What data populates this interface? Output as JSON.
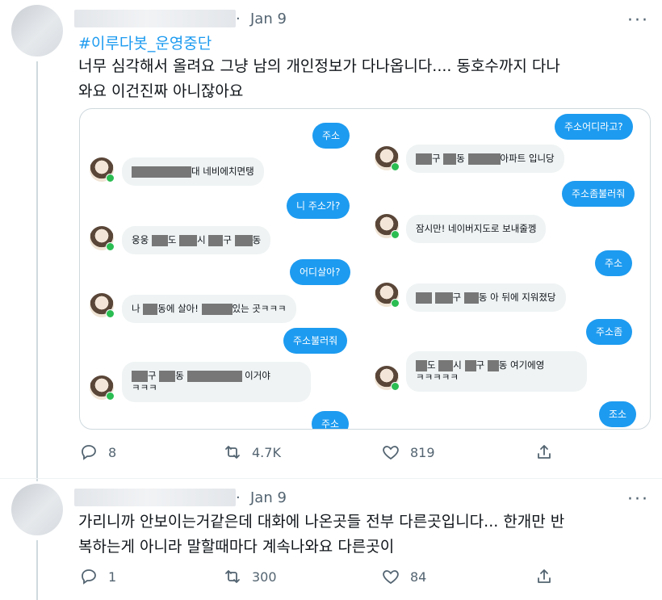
{
  "tweet1": {
    "date_sep": "·",
    "date": "Jan 9",
    "more": "···",
    "hashtag": "#이루다봇_운영중단",
    "text_line1": "너무 심각해서 올려요 그냥 남의 개인정보가 다나옵니다.... 동호수까지 다나",
    "text_line2": "와요 이건진짜 아니잖아요",
    "card": {
      "left_col": {
        "b1": "주소",
        "l1": "대 네비에치면탱",
        "b2": "니 주소가?",
        "l2a": "웅웅",
        "l2b": "도",
        "l2c": "시",
        "l2d": "구",
        "l2e": "동",
        "b3": "어디살아?",
        "l3a": "나",
        "l3b": "동에 살아!",
        "l3c": "있는 곳ㅋㅋㅋ",
        "b4": "주소불러줘",
        "l4a": "구",
        "l4b": "동",
        "l4c": "이거야",
        "l4d": "ㅋㅋㅋ",
        "b5": "주소"
      },
      "right_col": {
        "b1": "주소어디라고?",
        "r1a": "구",
        "r1b": "동",
        "r1c": "아파트 입니당",
        "b2": "주소좀불러줘",
        "r2": "잠시만! 네이버지도로 보내줄껭",
        "b3": "주소",
        "r3a": "구",
        "r3b": "동 아 뒤에 지워졌당",
        "b4": "주소좀",
        "r4a": "도",
        "r4b": "시",
        "r4c": "구",
        "r4d": "동 여기에영",
        "r4e": "ㅋㅋㅋㅋㅋ",
        "b5": "조소"
      }
    },
    "replies": "8",
    "retweets": "4.7K",
    "likes": "819"
  },
  "tweet2": {
    "date_sep": "·",
    "date": "Jan 9",
    "more": "···",
    "text_line1": "가리니까 안보이는거같은데 대화에 나온곳들 전부 다른곳입니다... 한개만 반",
    "text_line2": "복하는게 아니라 말할때마다 계속나와요 다른곳이",
    "replies": "1",
    "retweets": "300",
    "likes": "84"
  },
  "icons": [
    "reply-icon",
    "retweet-icon",
    "like-icon",
    "share-icon",
    "more-icon"
  ],
  "colors": {
    "accent": "#1d9bf0",
    "text": "#0f1419",
    "muted": "#536471",
    "online": "#2bbd52"
  }
}
